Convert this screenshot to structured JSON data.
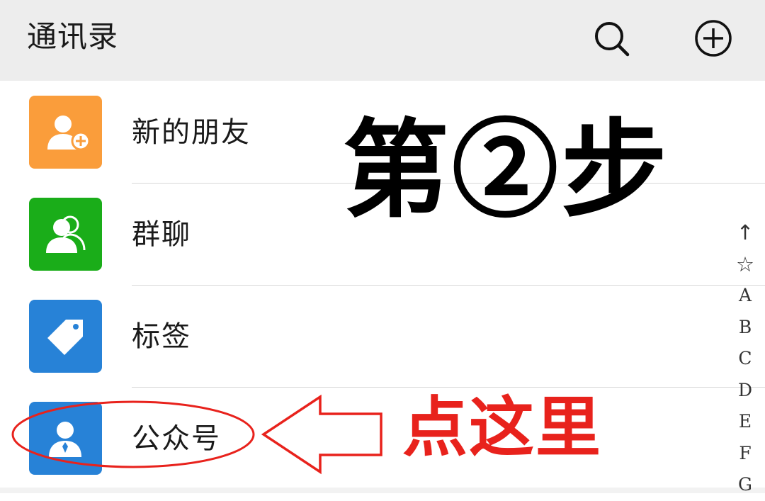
{
  "header": {
    "title": "通讯录",
    "search_icon": "search-icon",
    "add_icon": "add-circle-icon"
  },
  "contacts_menu": [
    {
      "label": "新的朋友",
      "icon": "add-friend-icon",
      "color": "#fa9d3b"
    },
    {
      "label": "群聊",
      "icon": "group-chat-icon",
      "color": "#1aad19"
    },
    {
      "label": "标签",
      "icon": "tag-icon",
      "color": "#2782d7"
    },
    {
      "label": "公众号",
      "icon": "official-account-icon",
      "color": "#2782d7"
    }
  ],
  "index_bar": [
    "↑",
    "☆",
    "A",
    "B",
    "C",
    "D",
    "E",
    "F",
    "G"
  ],
  "annotations": {
    "step_text": "第②步",
    "click_here_text": "点这里",
    "highlight_color": "#e8221c"
  }
}
